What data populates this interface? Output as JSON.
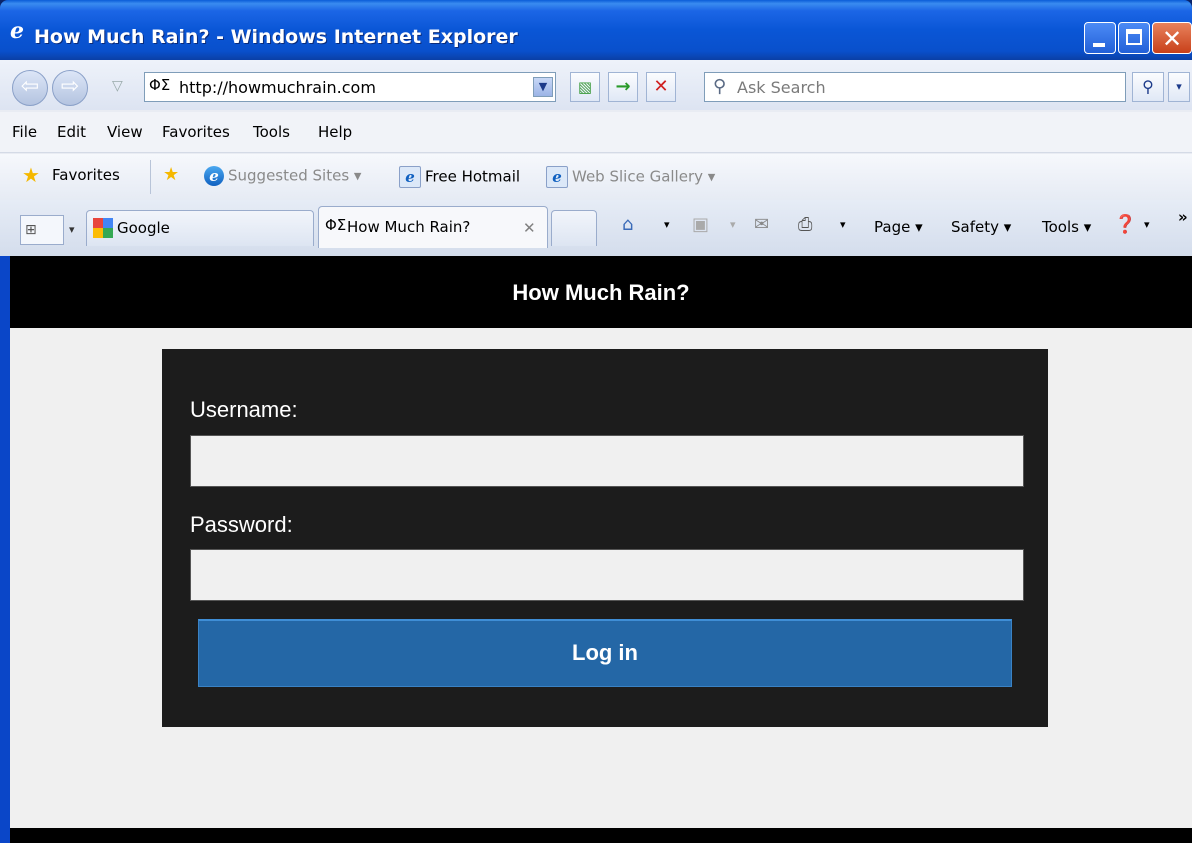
{
  "window": {
    "title": "How Much Rain? - Windows Internet Explorer"
  },
  "navbar": {
    "address": "http://howmuchrain.com",
    "search_placeholder": "Ask Search"
  },
  "menu": {
    "items": [
      "File",
      "Edit",
      "View",
      "Favorites",
      "Tools",
      "Help"
    ]
  },
  "favorites_bar": {
    "favorites_label": "Favorites",
    "items": [
      {
        "label": "Suggested Sites ▾",
        "icon": "ie-icon",
        "disabled": true
      },
      {
        "label": "Free Hotmail",
        "icon": "ie-page-icon",
        "disabled": false
      },
      {
        "label": "Web Slice Gallery ▾",
        "icon": "ie-page-icon",
        "disabled": true
      }
    ]
  },
  "tabs": {
    "items": [
      {
        "label": "Google",
        "icon": "google-icon",
        "active": false
      },
      {
        "label": "How Much Rain?",
        "icon": "site-icon",
        "active": true
      }
    ]
  },
  "command_bar": {
    "page": "Page ▾",
    "safety": "Safety ▾",
    "tools": "Tools ▾",
    "more": "»"
  },
  "site": {
    "header_title": "How Much Rain?",
    "username_label": "Username:",
    "username_value": "",
    "password_label": "Password:",
    "password_value": "",
    "login_button": "Log in"
  },
  "colors": {
    "header_bg": "#000000",
    "panel_bg": "#1c1c1c",
    "button_bg": "#2467a6",
    "page_bg": "#f0f0f0"
  }
}
